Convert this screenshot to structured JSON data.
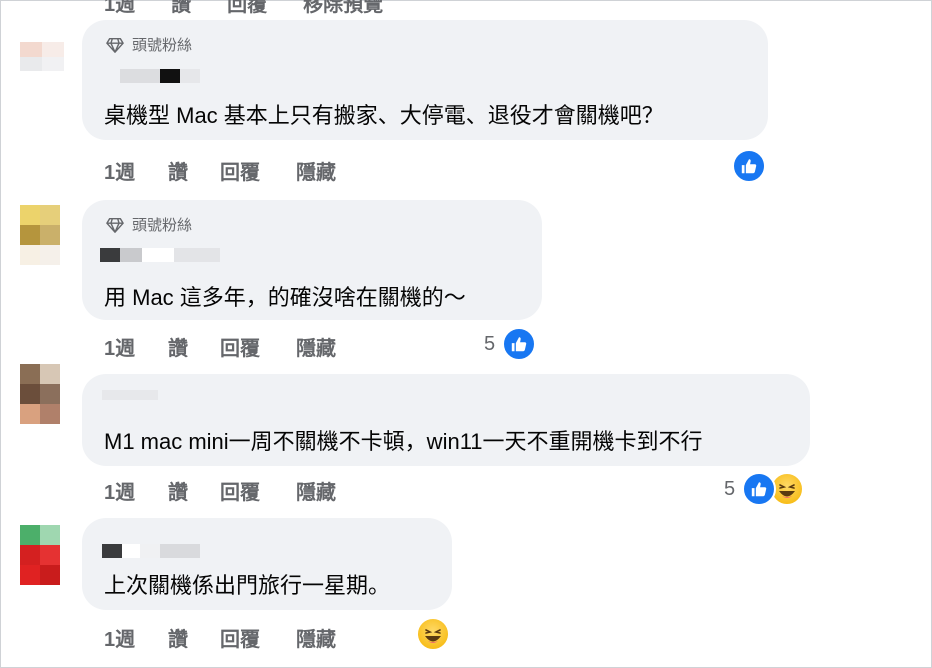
{
  "top_partial_actions": [
    "1週",
    "讚",
    "回覆",
    "移除預覽"
  ],
  "comments": [
    {
      "badge": "頭號粉絲",
      "text": "桌機型 Mac 基本上只有搬家、大停電、退役才會關機吧？",
      "actions": {
        "time": "1週",
        "like": "讚",
        "reply": "回覆",
        "hide": "隱藏"
      },
      "reactions": {
        "count": "",
        "types": [
          "like"
        ]
      }
    },
    {
      "badge": "頭號粉絲",
      "text": "用 Mac 這多年，的確沒啥在關機的～",
      "actions": {
        "time": "1週",
        "like": "讚",
        "reply": "回覆",
        "hide": "隱藏"
      },
      "reactions": {
        "count": "5",
        "types": [
          "like"
        ]
      }
    },
    {
      "badge": "",
      "text": "M1 mac mini一周不關機不卡頓，win11一天不重開機卡到不行",
      "actions": {
        "time": "1週",
        "like": "讚",
        "reply": "回覆",
        "hide": "隱藏"
      },
      "reactions": {
        "count": "5",
        "types": [
          "like",
          "haha"
        ]
      }
    },
    {
      "badge": "",
      "text": "上次關機係出門旅行一星期。",
      "actions": {
        "time": "1週",
        "like": "讚",
        "reply": "回覆",
        "hide": "隱藏"
      },
      "reactions": {
        "count": "",
        "types": [
          "haha"
        ]
      }
    }
  ],
  "colors": {
    "bubble": "#f0f2f5",
    "action_text": "#65676b",
    "like_blue": "#1877f2",
    "haha_yellow": "#f7c325"
  },
  "icons": [
    "gem-icon",
    "like-reaction-icon",
    "haha-reaction-icon"
  ]
}
